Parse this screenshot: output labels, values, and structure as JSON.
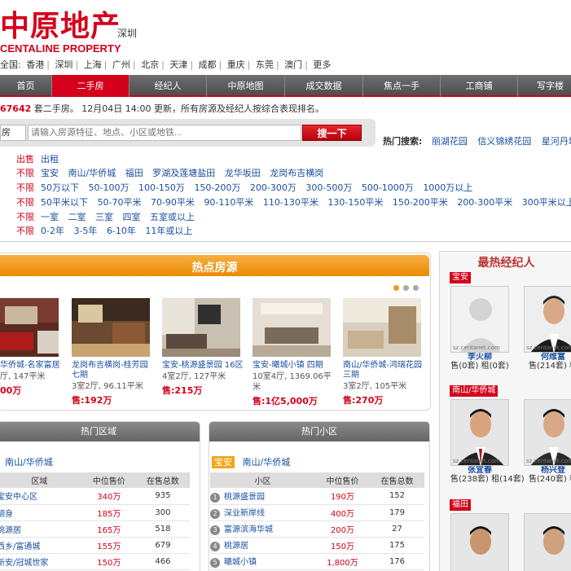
{
  "header": {
    "logo_cn": "中原地产",
    "logo_en": "CENTALINE PROPERTY",
    "current_city": "深圳",
    "city_label": "全国:",
    "cities": [
      "香港",
      "深圳",
      "上海",
      "广州",
      "北京",
      "天津",
      "成都",
      "重庆",
      "东莞",
      "澳门",
      "更多"
    ]
  },
  "nav": {
    "items": [
      "首页",
      "二手房",
      "经纪人",
      "中原地图",
      "成交数据",
      "焦点一手",
      "工商铺",
      "写字楼"
    ],
    "active": "二手房"
  },
  "stats": {
    "count": "67642",
    "text": "套二手房。 12月04日 14:00 更新，所有房源及经纪人按综合表现排名。"
  },
  "search": {
    "type": "房",
    "placeholder": "请输入房源特征、地点、小区或地铁...",
    "button": "搜一下",
    "hot_label": "热门搜索:",
    "hot_terms": [
      "丽湖花园",
      "信义锦绣花园",
      "星河丹堤花园"
    ]
  },
  "filters": [
    {
      "first": "出售",
      "options": [
        "出租"
      ]
    },
    {
      "first": "不限",
      "options": [
        "宝安",
        "南山/华侨城",
        "福田",
        "罗湖及莲塘盐田",
        "龙华坂田",
        "龙岗布吉横岗"
      ]
    },
    {
      "first": "不限",
      "options": [
        "50万以下",
        "50-100万",
        "100-150万",
        "150-200万",
        "200-300万",
        "300-500万",
        "500-1000万",
        "1000万以上"
      ]
    },
    {
      "first": "不限",
      "options": [
        "50平米以下",
        "50-70平米",
        "70-90平米",
        "90-110平米",
        "110-130平米",
        "130-150平米",
        "150-200平米",
        "200-300平米",
        "300平米以上"
      ]
    },
    {
      "first": "不限",
      "options": [
        "一室",
        "二室",
        "三室",
        "四室",
        "五室或以上"
      ]
    },
    {
      "first": "不限",
      "options": [
        "0-2年",
        "3-5年",
        "6-10年",
        "11年或以上"
      ]
    }
  ],
  "hot_listings": {
    "title": "热点房源",
    "items": [
      {
        "name": "华侨城-名家富居",
        "spec": "厅, 147平米",
        "price": "00万"
      },
      {
        "name": "龙岗布吉横岗-桂芳园七期",
        "spec": "3室2厅, 96.11平米",
        "price": "售:192万"
      },
      {
        "name": "宝安-桃源盛景园 16区",
        "spec": "4室2厅, 127平米",
        "price": "售:215万"
      },
      {
        "name": "宝安-曦城小镇 四期",
        "spec": "10室4厅, 1369.06平米",
        "price": "售:1亿5,000万"
      },
      {
        "name": "南山/华侨城-鸿瑞花园三期",
        "spec": "3室2厅, 105平米",
        "price": "售:270万"
      }
    ]
  },
  "hot_areas": {
    "tab": "热门区域",
    "selected": "南山/华侨城",
    "headers": [
      "区域",
      "中位售价",
      "在售总数"
    ],
    "rows": [
      [
        "宝安中心区",
        "340万",
        "935"
      ],
      [
        "翻身",
        "185万",
        "300"
      ],
      [
        "桃源居",
        "165万",
        "518"
      ],
      [
        "西乡/富通城",
        "155万",
        "679"
      ],
      [
        "新安/冠城世家",
        "150万",
        "466"
      ]
    ]
  },
  "hot_communities": {
    "tab": "热门小区",
    "tag": "宝安",
    "selected": "南山/华侨城",
    "headers": [
      "小区",
      "中位售价",
      "在售总数"
    ],
    "rows": [
      [
        "1",
        "桃源盛景园",
        "190万",
        "152"
      ],
      [
        "2",
        "深业新岸线",
        "400万",
        "179"
      ],
      [
        "3",
        "富源滨海华城",
        "200万",
        "27"
      ],
      [
        "4",
        "桃源居",
        "150万",
        "175"
      ],
      [
        "5",
        "曦城小镇",
        "1,800万",
        "176"
      ]
    ]
  },
  "agents": {
    "title": "最热经纪人",
    "groups": [
      {
        "region": "宝安",
        "agents": [
          {
            "name": "李火柳",
            "count": "售(0套) 租(0套)",
            "watermark": "sz.centanet.com"
          },
          {
            "name": "何维富",
            "count": "售(214套) 租",
            "watermark": "sz.centanet.com"
          }
        ]
      },
      {
        "region": "南山/华侨城",
        "agents": [
          {
            "name": "张宜春",
            "count": "售(238套) 租(14套)",
            "watermark": "sz.centanet.com"
          },
          {
            "name": "杨兴登",
            "count": "售(240套) 租",
            "watermark": "sz.centanet.com"
          }
        ]
      },
      {
        "region": "福田",
        "agents": [
          {
            "name": "",
            "count": "",
            "watermark": ""
          },
          {
            "name": "",
            "count": "",
            "watermark": ""
          }
        ]
      }
    ]
  },
  "colors": {
    "brand_red": "#d4001c",
    "orange": "#ec8a05",
    "link_blue": "#1a4fa0"
  }
}
